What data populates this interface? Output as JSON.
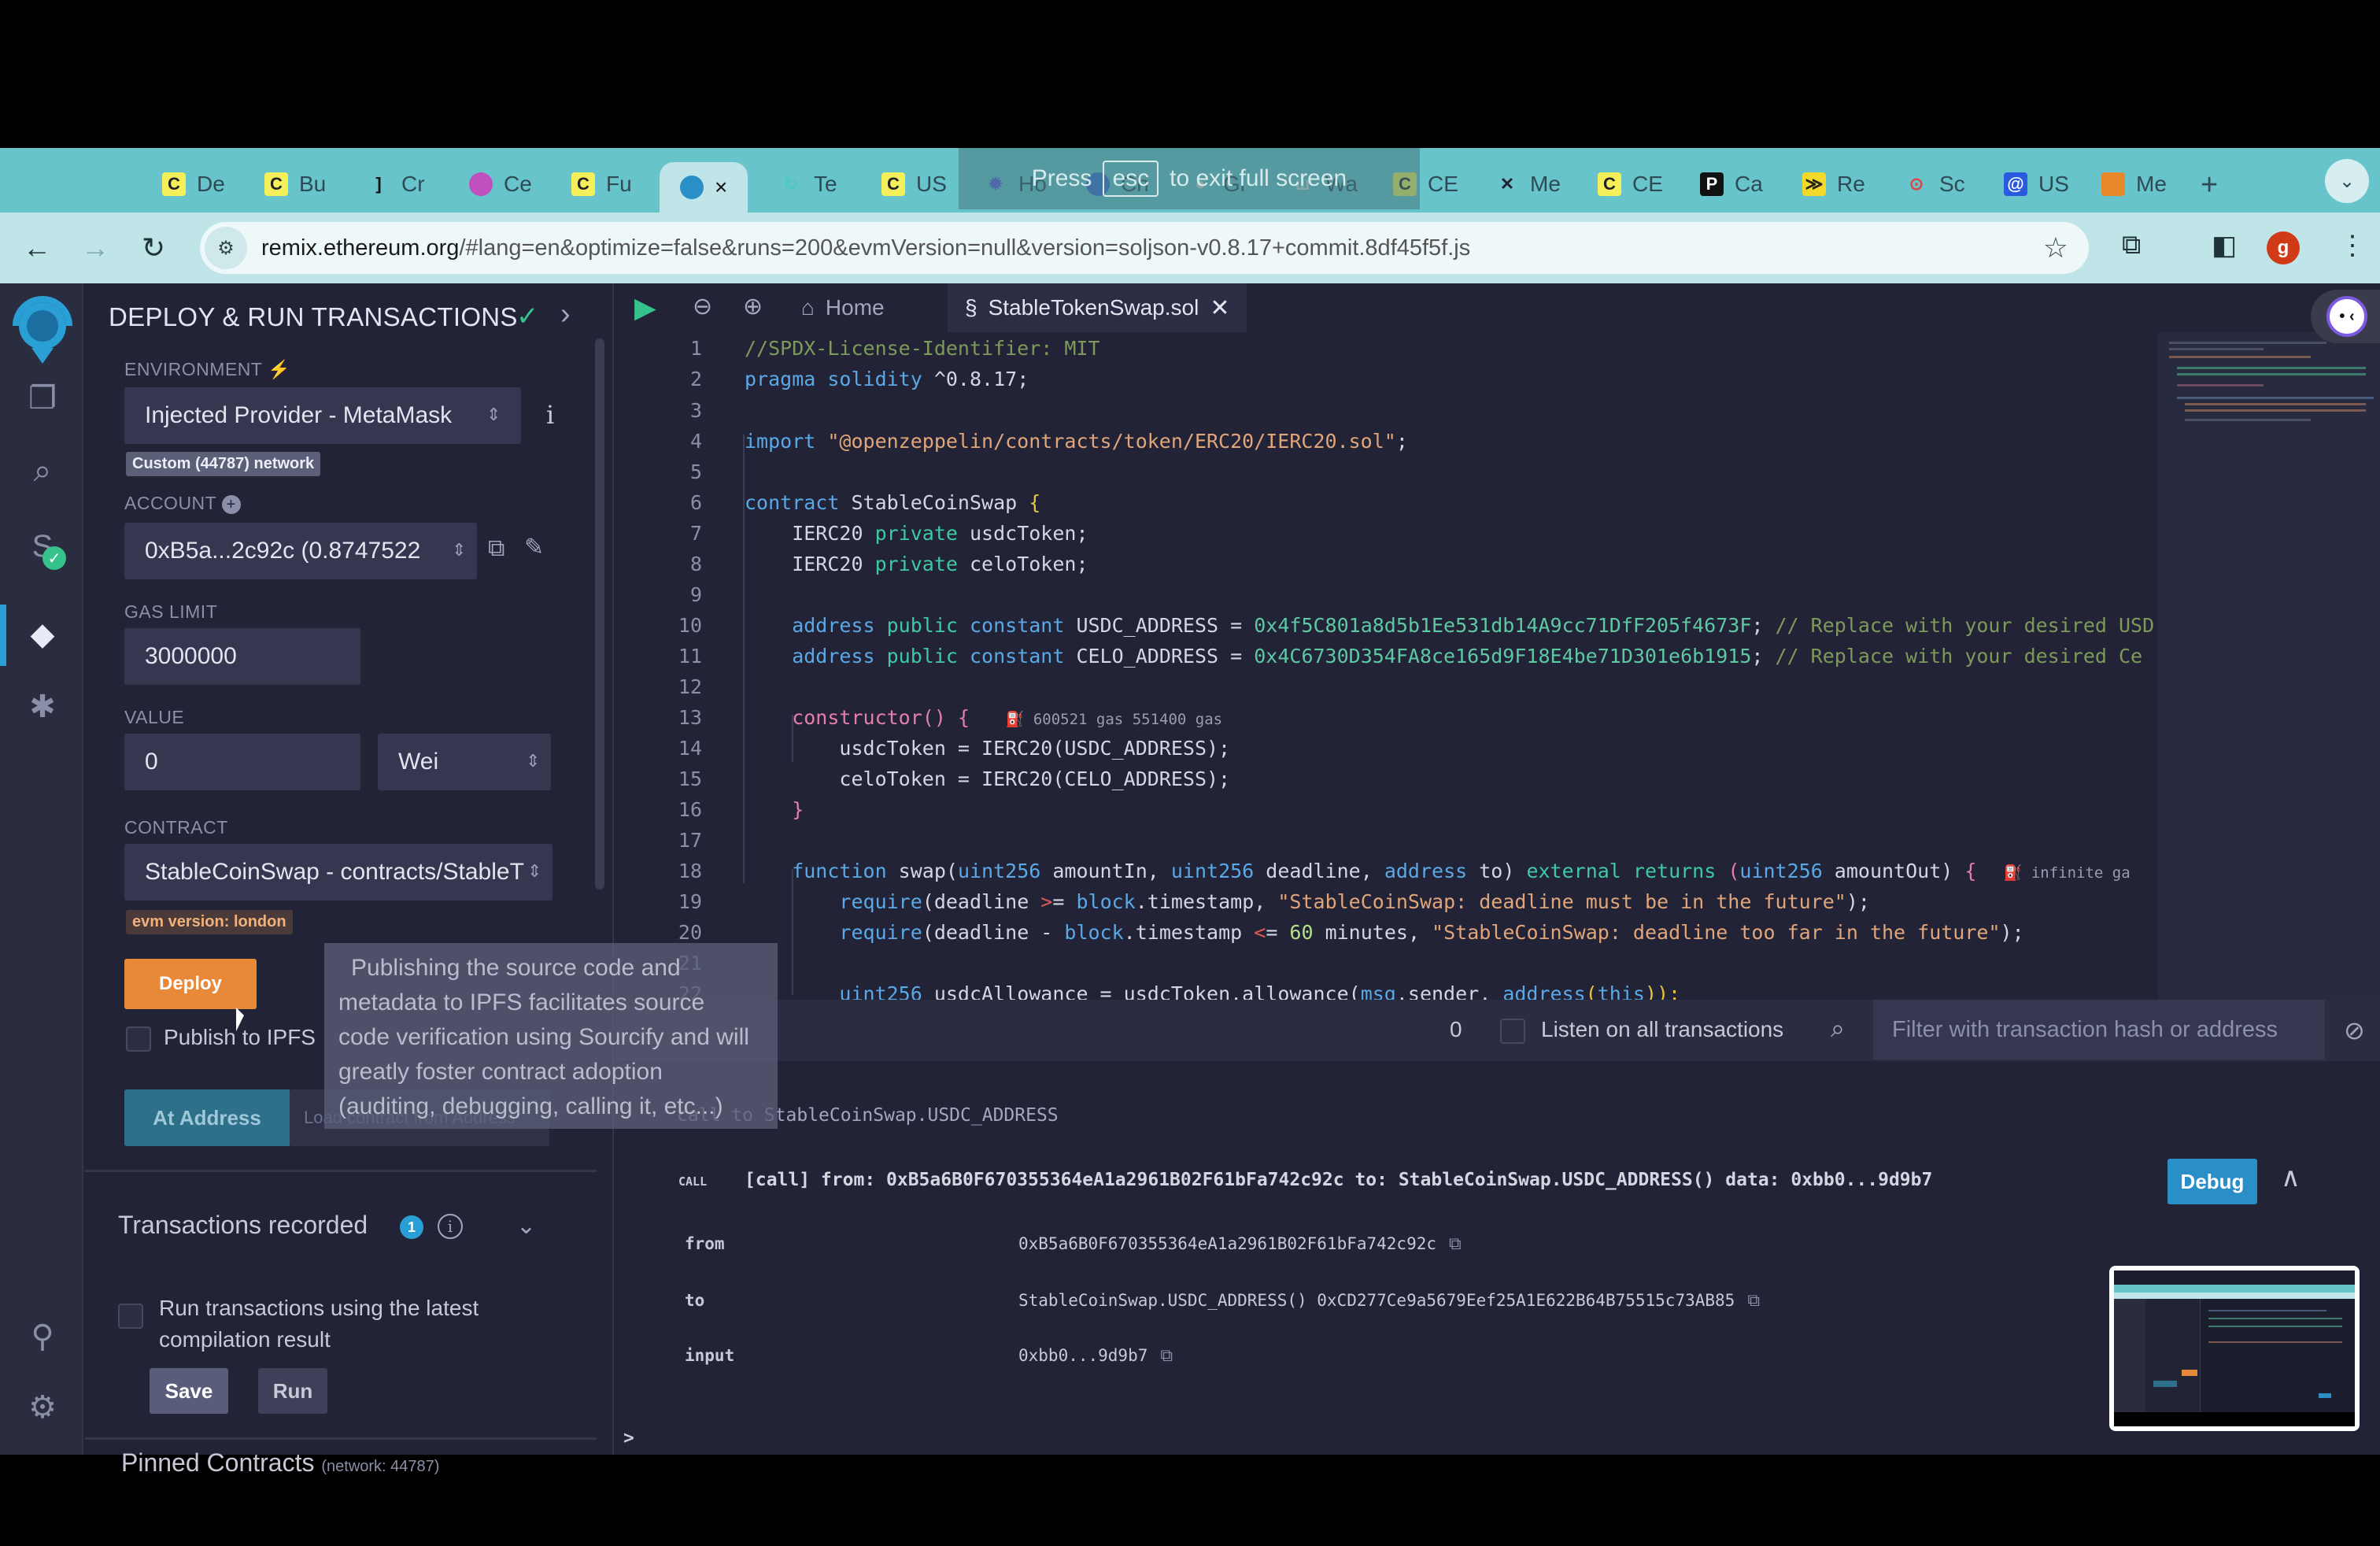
{
  "browser": {
    "fullscreen_notice": {
      "prefix": "Press",
      "key": "esc",
      "suffix": "to exit full screen"
    },
    "tabs": [
      {
        "label": "De",
        "icon": "celo-c-icon"
      },
      {
        "label": "Bu",
        "icon": "celo-c-icon"
      },
      {
        "label": "Cr",
        "icon": "bracket-icon"
      },
      {
        "label": "Ce",
        "icon": "pink-gem-icon"
      },
      {
        "label": "Fu",
        "icon": "celo-c-icon"
      },
      {
        "label": "×",
        "icon": "remix-icon",
        "active": true
      },
      {
        "label": "Te",
        "icon": "swirl-icon"
      },
      {
        "label": "US",
        "icon": "celo-c-icon"
      },
      {
        "label": "Ho",
        "icon": "gear-flower-icon"
      },
      {
        "label": "Ch",
        "icon": "chat-icon"
      },
      {
        "label": "Gi",
        "icon": "github-icon"
      },
      {
        "label": "Wa",
        "icon": "w-icon"
      },
      {
        "label": "CE",
        "icon": "celo-c-icon"
      },
      {
        "label": "Me",
        "icon": "cross-x-icon"
      },
      {
        "label": "CE",
        "icon": "celo-c-icon"
      },
      {
        "label": "Ca",
        "icon": "p-icon"
      },
      {
        "label": "Re",
        "icon": "stripes-icon"
      },
      {
        "label": "Sc",
        "icon": "screenshot-icon"
      },
      {
        "label": "US",
        "icon": "at-icon"
      },
      {
        "label": "Me",
        "icon": "metamask-fox-icon"
      }
    ],
    "new_tab": "+",
    "url_host": "remix.ethereum.org",
    "url_rest": "/#lang=en&optimize=false&runs=200&evmVersion=null&version=soljson-v0.8.17+commit.8df45f5f.js",
    "profile_initial": "g"
  },
  "side_panel": {
    "title": "DEPLOY & RUN TRANSACTIONS",
    "environment_label": "ENVIRONMENT",
    "environment_value": "Injected Provider - MetaMask",
    "network_badge": "Custom (44787) network",
    "account_label": "ACCOUNT",
    "account_value": "0xB5a...2c92c (0.8747522",
    "gas_limit_label": "GAS LIMIT",
    "gas_limit_value": "3000000",
    "value_label": "VALUE",
    "value_value": "0",
    "value_unit": "Wei",
    "contract_label": "CONTRACT",
    "contract_value": "StableCoinSwap - contracts/StableT",
    "evm_badge": "evm version: london",
    "deploy_label": "Deploy",
    "publish_label": "Publish to IPFS",
    "at_address_label": "At Address",
    "load_contract_placeholder": "Load contract from Address",
    "transactions_recorded_label": "Transactions recorded",
    "transactions_recorded_count": "1",
    "run_latest_label_1": "Run transactions using the latest",
    "run_latest_label_2": "compilation result",
    "save_label": "Save",
    "run_label": "Run",
    "pinned_label": "Pinned Contracts",
    "pinned_sub": "(network: 44787)"
  },
  "tooltip": {
    "lines": [
      "Publishing the source code and",
      "metadata to IPFS facilitates source",
      "code verification using Sourcify and will",
      "greatly foster contract adoption",
      "(auditing, debugging, calling it, etc...)"
    ]
  },
  "editor": {
    "home_tab": "Home",
    "file_tab": "StableTokenSwap.sol",
    "line_numbers": [
      "1",
      "2",
      "3",
      "4",
      "5",
      "6",
      "7",
      "8",
      "9",
      "10",
      "11",
      "12",
      "13",
      "14",
      "15",
      "16",
      "17",
      "18",
      "19",
      "20",
      "21",
      "22"
    ],
    "lines": {
      "l1": "//SPDX-License-Identifier: MIT",
      "l2a": "pragma solidity",
      "l2b": " ^0.8.17;",
      "l4a": "import",
      "l4b": " \"@openzeppelin/contracts/token/ERC20/IERC20.sol\"",
      "l4c": ";",
      "l6a": "contract",
      "l6b": " StableCoinSwap ",
      "l6c": "{",
      "l7a": "    IERC20 ",
      "l7b": "private",
      "l7c": " usdcToken;",
      "l8a": "    IERC20 ",
      "l8b": "private",
      "l8c": " celoToken;",
      "l10a": "    address",
      "l10b": " public",
      "l10c": " constant",
      "l10d": " USDC_ADDRESS = ",
      "l10e": "0x4f5C801a8d5b1Ee531db14A9cc71DfF205f4673F",
      "l10f": "; ",
      "l10g": "// Replace with your desired USD",
      "l11a": "    address",
      "l11b": " public",
      "l11c": " constant",
      "l11d": " CELO_ADDRESS = ",
      "l11e": "0x4C6730D354FA8ce165d9F18E4be71D301e6b1915",
      "l11f": "; ",
      "l11g": "// Replace with your desired Ce",
      "l13a": "    constructor",
      "l13b": "() ",
      "l13c": "{",
      "l13gas": "600521 gas 551400 gas",
      "l14": "        usdcToken = IERC20(USDC_ADDRESS);",
      "l15": "        celoToken = IERC20(CELO_ADDRESS);",
      "l16": "    }",
      "l18a": "    function",
      "l18b": " swap(",
      "l18c": "uint256",
      "l18d": " amountIn, ",
      "l18e": "uint256",
      "l18f": " deadline, ",
      "l18g": "address",
      "l18h": " to) ",
      "l18i": "external",
      "l18j": " returns",
      "l18k": " (",
      "l18l": "uint256",
      "l18m": " amountOut) ",
      "l18n": "{",
      "l18gas": "infinite ga",
      "l19a": "        require",
      "l19b": "(deadline ",
      "l19c": ">",
      "l19d": "= ",
      "l19e": "block",
      "l19f": ".timestamp, ",
      "l19g": "\"StableCoinSwap: deadline must be in the future\"",
      "l19h": ");",
      "l20a": "        require",
      "l20b": "(deadline - ",
      "l20c": "block",
      "l20d": ".timestamp ",
      "l20e": "<",
      "l20f": "= ",
      "l20g": "60",
      "l20h": " minutes, ",
      "l20i": "\"StableCoinSwap: deadline too far in the future\"",
      "l20j": ");",
      "l22a": "        uint256",
      "l22b": " usdcAllowance = usdcToken.allowance(",
      "l22c": "msg",
      "l22d": ".sender, ",
      "l22e": "address",
      "l22f": "(",
      "l22g": "this",
      "l22h": "));"
    }
  },
  "terminal": {
    "pending_count": "0",
    "listen_label": "Listen on all transactions",
    "filter_placeholder": "Filter with transaction hash or address",
    "call_note": "call to StableCoinSwap.USDC_ADDRESS",
    "call_tag": "CALL",
    "call_summary": "[call] from: 0xB5a6B0F670355364eA1a2961B02F61bFa742c92c to: StableCoinSwap.USDC_ADDRESS() data: 0xbb0...9d9b7",
    "debug_label": "Debug",
    "rows": [
      {
        "key": "from",
        "value": "0xB5a6B0F670355364eA1a2961B02F61bFa742c92c"
      },
      {
        "key": "to",
        "value": "StableCoinSwap.USDC_ADDRESS() 0xCD277Ce9a5679Eef25A1E622B64B75515c73AB85"
      },
      {
        "key": "input",
        "value": "0xbb0...9d9b7"
      }
    ],
    "prompt": ">"
  },
  "colors": {
    "accent_blue": "#2a9fd6",
    "deploy_orange": "#e8893a",
    "success_green": "#35c28b",
    "bg": "#222336"
  }
}
